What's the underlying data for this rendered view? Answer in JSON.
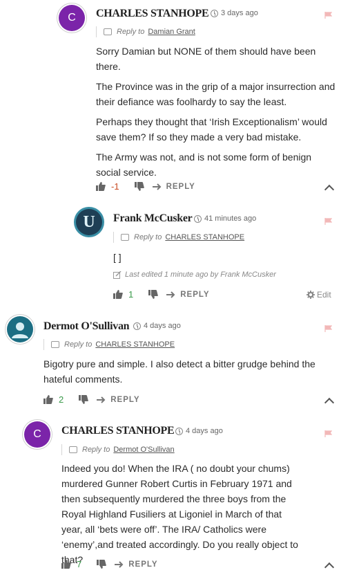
{
  "comments": [
    {
      "author": "CHARLES STANHOPE",
      "avatar_letter": "C",
      "time": "3 days ago",
      "reply_prefix": "Reply to",
      "reply_target": "Damian Grant",
      "paragraphs": [
        "Sorry Damian but NONE of them should have been there.",
        "The Province was in the grip of a major insurrection and their defiance was foolhardy to say the least.",
        "Perhaps they thought that ‘Irish Exceptionalism’ would save them? If so they made a very bad mistake.",
        "The Army was not, and is not some form of benign social service."
      ],
      "votes": "-1",
      "reply_label": "REPLY"
    },
    {
      "author": "Frank McCusker",
      "avatar_letter": "U",
      "time": "41 minutes ago",
      "reply_prefix": "Reply to",
      "reply_target": "CHARLES STANHOPE",
      "paragraphs": [
        "[ ]"
      ],
      "edited_note": "Last edited 1 minute ago by Frank McCusker",
      "votes": "1",
      "reply_label": "REPLY",
      "edit_label": "Edit"
    },
    {
      "author": "Dermot O'Sullivan",
      "time": "4 days ago",
      "reply_prefix": "Reply to",
      "reply_target": "CHARLES STANHOPE",
      "paragraphs": [
        "Bigotry pure and simple. I also detect a bitter grudge behind the hateful comments."
      ],
      "votes": "2",
      "reply_label": "REPLY"
    },
    {
      "author": "CHARLES STANHOPE",
      "avatar_letter": "C",
      "time": "4 days ago",
      "reply_prefix": "Reply to",
      "reply_target": "Dermot O'Sullivan",
      "paragraphs": [
        "Indeed you do! When the IRA ( no doubt your chums) murdered Gunner Robert Curtis in February 1971 and then subsequently murdered the three boys from the Royal Highland Fusiliers at Ligoniel in March of that year, all ‘bets were off’. The IRA/ Catholics were ‘enemy’,and treated accordingly. Do you really object to that?"
      ],
      "votes": "7",
      "reply_label": "REPLY"
    }
  ],
  "colors": {
    "negative": "#c8471e",
    "positive": "#3a9a4a",
    "flag": "#f2b8b8",
    "purple_avatar": "#7b24a9",
    "teal_avatar": "#1c6e83"
  },
  "icons": [
    "flag-icon",
    "clock-icon",
    "reply-bubble-icon",
    "thumbs-up-icon",
    "thumbs-down-icon",
    "reply-arrow-icon",
    "chevron-up-icon",
    "pencil-icon",
    "gear-icon"
  ]
}
